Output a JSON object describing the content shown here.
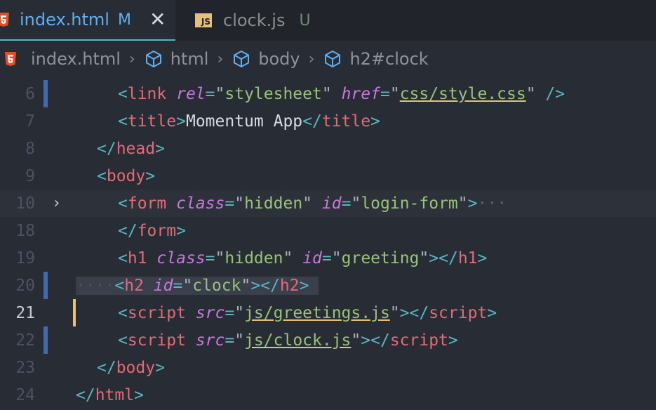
{
  "tabs": [
    {
      "label": "index.html",
      "status": "M",
      "close": "✕"
    },
    {
      "label": "clock.js",
      "status": "U",
      "icon_text": "JS"
    }
  ],
  "breadcrumb": {
    "file": "index.html",
    "items": [
      "html",
      "body",
      "h2#clock"
    ],
    "separator": "›"
  },
  "editor": {
    "lines": [
      {
        "num": "6"
      },
      {
        "num": "7"
      },
      {
        "num": "8"
      },
      {
        "num": "9"
      },
      {
        "num": "10"
      },
      {
        "num": "18"
      },
      {
        "num": "19"
      },
      {
        "num": "20"
      },
      {
        "num": "21"
      },
      {
        "num": "22"
      },
      {
        "num": "23"
      },
      {
        "num": "24"
      }
    ],
    "text": {
      "l6_tag": "link",
      "l6_a1": "rel",
      "l6_v1": "stylesheet",
      "l6_a2": "href",
      "l6_v2": "css/style.css",
      "l6_end": "/>",
      "l7_tag": "title",
      "l7_text": "Momentum App",
      "l8_tag": "head",
      "l9_tag": "body",
      "l10_tag": "form",
      "l10_a1": "class",
      "l10_v1": "hidden",
      "l10_a2": "id",
      "l10_v2": "login-form",
      "l10_more": "···",
      "l18_tag": "form",
      "l19_tag": "h1",
      "l19_a1": "class",
      "l19_v1": "hidden",
      "l19_a2": "id",
      "l19_v2": "greeting",
      "l20_ws": "····",
      "l20_tag": "h2",
      "l20_a1": "id",
      "l20_v1": "clock",
      "l21_tag": "script",
      "l21_a1": "src",
      "l21_v1": "js/greetings.js",
      "l22_tag": "script",
      "l22_a1": "src",
      "l22_v1": "js/clock.js",
      "l23_tag": "body",
      "l24_tag": "html"
    }
  },
  "colors": {
    "background": "#282c34",
    "tag": "#e06c75",
    "attribute": "#c678dd",
    "string": "#98c379",
    "bracket": "#56b6c2",
    "accent": "#61afef"
  }
}
